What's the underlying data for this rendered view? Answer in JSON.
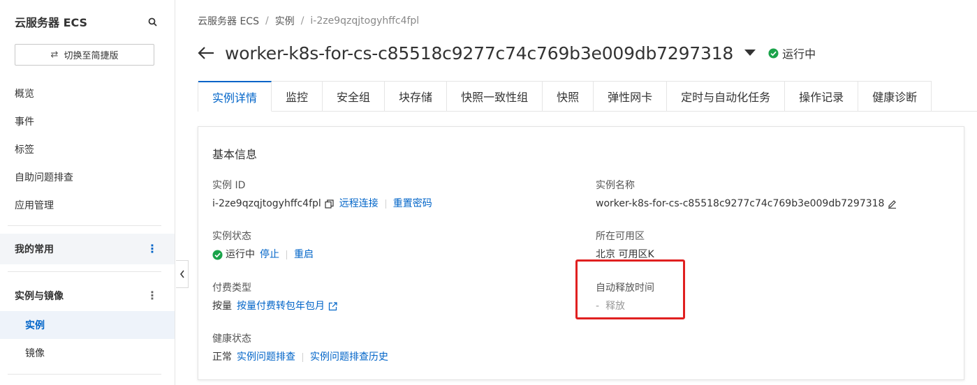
{
  "sidebar": {
    "title": "云服务器 ECS",
    "switch_label": "切换至简捷版",
    "items": [
      {
        "label": "概览"
      },
      {
        "label": "事件"
      },
      {
        "label": "标签"
      },
      {
        "label": "自助问题排查"
      },
      {
        "label": "应用管理"
      }
    ],
    "favorites_group": "我的常用",
    "instance_group": "实例与镜像",
    "sub_items": [
      {
        "label": "实例",
        "active": true
      },
      {
        "label": "镜像",
        "active": false
      }
    ]
  },
  "breadcrumb": [
    "云服务器 ECS",
    "实例",
    "i-2ze9qzqjtogyhffc4fpl"
  ],
  "header": {
    "title": "worker-k8s-for-cs-c85518c9277c74c769b3e009db7297318",
    "status": "运行中"
  },
  "tabs": [
    "实例详情",
    "监控",
    "安全组",
    "块存储",
    "快照一致性组",
    "快照",
    "弹性网卡",
    "定时与自动化任务",
    "操作记录",
    "健康诊断"
  ],
  "card": {
    "title": "基本信息",
    "instance_id": {
      "label": "实例 ID",
      "value": "i-2ze9qzqjtogyhffc4fpl",
      "link_remote": "远程连接",
      "link_reset": "重置密码"
    },
    "instance_name": {
      "label": "实例名称",
      "value": "worker-k8s-for-cs-c85518c9277c74c769b3e009db7297318"
    },
    "instance_status": {
      "label": "实例状态",
      "value": "运行中",
      "link_stop": "停止",
      "link_restart": "重启"
    },
    "zone": {
      "label": "所在可用区",
      "value": "北京 可用区K"
    },
    "billing": {
      "label": "付费类型",
      "value": "按量",
      "link_convert": "按量付费转包年包月"
    },
    "auto_release": {
      "label": "自动释放时间",
      "value": "-",
      "link_release": "释放"
    },
    "health": {
      "label": "健康状态",
      "value": "正常",
      "link_troubleshoot": "实例问题排查",
      "link_history": "实例问题排查历史"
    }
  },
  "colors": {
    "accent": "#0064c8",
    "running_green": "#1aa34a",
    "highlight_red": "#e02020"
  }
}
